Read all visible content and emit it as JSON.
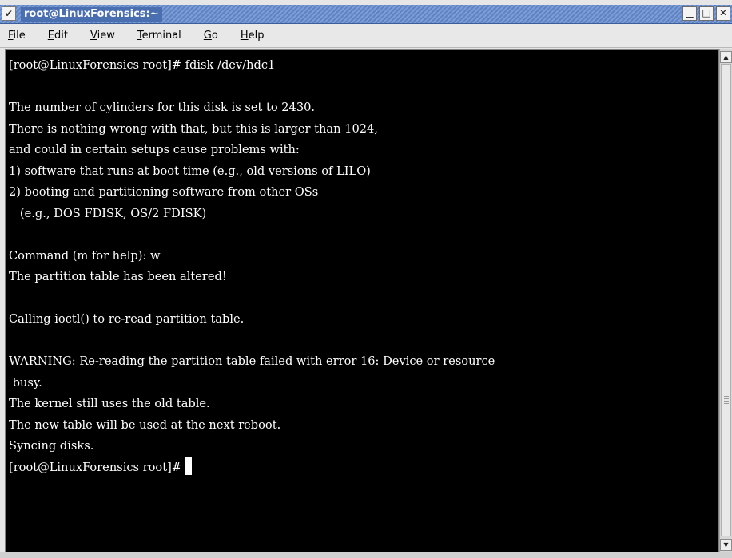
{
  "window": {
    "title": "root@LinuxForensics:~",
    "menu_icon": "chevron-down-icon",
    "buttons": [
      "minimize-icon",
      "maximize-icon",
      "close-icon"
    ]
  },
  "menubar": {
    "items": [
      {
        "first": "F",
        "rest": "ile"
      },
      {
        "first": "E",
        "rest": "dit"
      },
      {
        "first": "V",
        "rest": "iew"
      },
      {
        "first": "T",
        "rest": "erminal"
      },
      {
        "first": "G",
        "rest": "o"
      },
      {
        "first": "H",
        "rest": "elp"
      }
    ]
  },
  "terminal": {
    "lines": [
      "[root@LinuxForensics root]# fdisk /dev/hdc1",
      "",
      "The number of cylinders for this disk is set to 2430.",
      "There is nothing wrong with that, but this is larger than 1024,",
      "and could in certain setups cause problems with:",
      "1) software that runs at boot time (e.g., old versions of LILO)",
      "2) booting and partitioning software from other OSs",
      "   (e.g., DOS FDISK, OS/2 FDISK)",
      "",
      "Command (m for help): w",
      "The partition table has been altered!",
      "",
      "Calling ioctl() to re-read partition table.",
      "",
      "WARNING: Re-reading the partition table failed with error 16: Device or resource",
      " busy.",
      "The kernel still uses the old table.",
      "The new table will be used at the next reboot.",
      "Syncing disks."
    ],
    "prompt": "[root@LinuxForensics root]#"
  },
  "colors": {
    "terminal_bg": "#000000",
    "terminal_fg": "#ffffff",
    "titlebar": "#5f84c4"
  }
}
